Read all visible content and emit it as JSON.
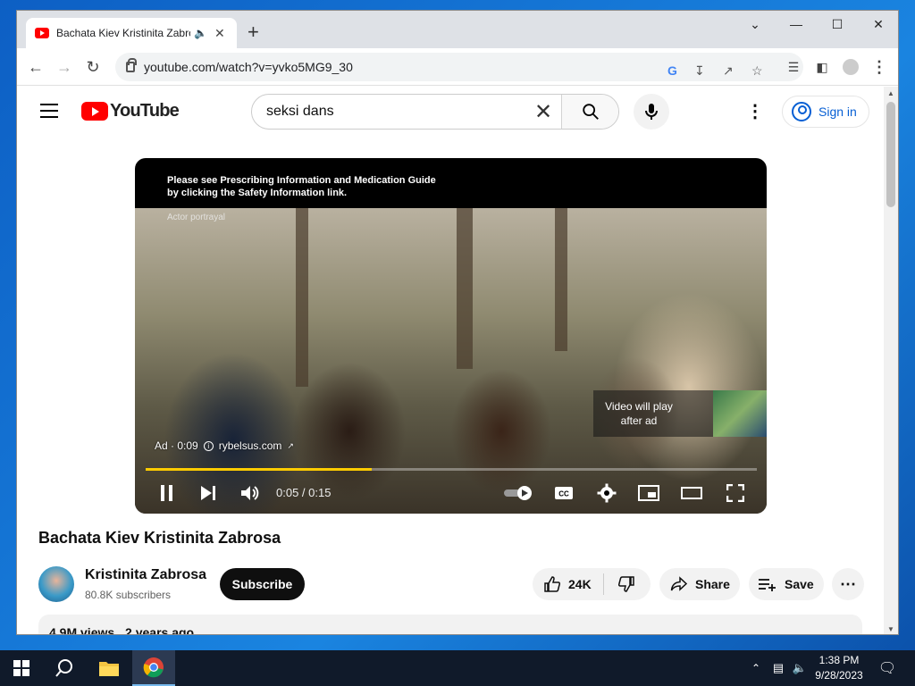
{
  "browser": {
    "tab_title": "Bachata Kiev Kristinita Zabrosa",
    "url": "youtube.com/watch?v=yvko5MG9_30",
    "new_tab": "+"
  },
  "youtube": {
    "logo_text": "YouTube",
    "search_value": "seksi dans",
    "sign_in": "Sign in"
  },
  "player": {
    "disclaimer_line1": "Please see Prescribing Information and Medication Guide",
    "disclaimer_line2": "by clicking the Safety Information link.",
    "actor_note": "Actor portrayal",
    "ad_label": "Ad · 0:09",
    "ad_link": "rybelsus.com",
    "skip_text_line1": "Video will play",
    "skip_text_line2": "after ad",
    "time": "0:05 / 0:15",
    "progress_fraction": 0.37,
    "progress_color": "#ffcc00"
  },
  "video": {
    "title": "Bachata Kiev Kristinita Zabrosa",
    "channel_name": "Kristinita Zabrosa",
    "subscribers": "80.8K subscribers",
    "subscribe_label": "Subscribe",
    "likes": "24K",
    "share_label": "Share",
    "save_label": "Save",
    "views": "4.9M views",
    "age": "2 years ago"
  },
  "taskbar": {
    "time": "1:38 PM",
    "date": "9/28/2023"
  }
}
